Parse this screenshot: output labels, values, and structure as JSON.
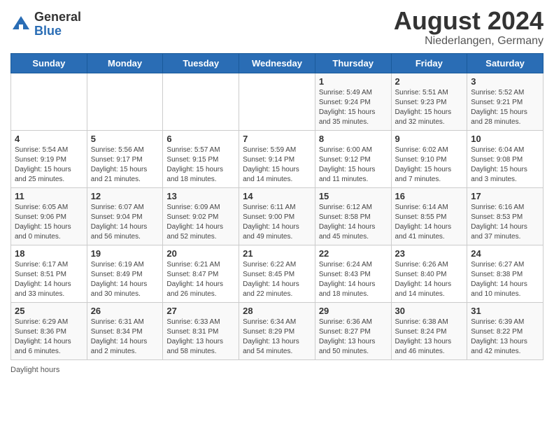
{
  "header": {
    "logo_general": "General",
    "logo_blue": "Blue",
    "month_year": "August 2024",
    "location": "Niederlangen, Germany"
  },
  "footer": {
    "daylight_label": "Daylight hours"
  },
  "days_of_week": [
    "Sunday",
    "Monday",
    "Tuesday",
    "Wednesday",
    "Thursday",
    "Friday",
    "Saturday"
  ],
  "weeks": [
    [
      {
        "day": "",
        "info": ""
      },
      {
        "day": "",
        "info": ""
      },
      {
        "day": "",
        "info": ""
      },
      {
        "day": "",
        "info": ""
      },
      {
        "day": "1",
        "info": "Sunrise: 5:49 AM\nSunset: 9:24 PM\nDaylight: 15 hours\nand 35 minutes."
      },
      {
        "day": "2",
        "info": "Sunrise: 5:51 AM\nSunset: 9:23 PM\nDaylight: 15 hours\nand 32 minutes."
      },
      {
        "day": "3",
        "info": "Sunrise: 5:52 AM\nSunset: 9:21 PM\nDaylight: 15 hours\nand 28 minutes."
      }
    ],
    [
      {
        "day": "4",
        "info": "Sunrise: 5:54 AM\nSunset: 9:19 PM\nDaylight: 15 hours\nand 25 minutes."
      },
      {
        "day": "5",
        "info": "Sunrise: 5:56 AM\nSunset: 9:17 PM\nDaylight: 15 hours\nand 21 minutes."
      },
      {
        "day": "6",
        "info": "Sunrise: 5:57 AM\nSunset: 9:15 PM\nDaylight: 15 hours\nand 18 minutes."
      },
      {
        "day": "7",
        "info": "Sunrise: 5:59 AM\nSunset: 9:14 PM\nDaylight: 15 hours\nand 14 minutes."
      },
      {
        "day": "8",
        "info": "Sunrise: 6:00 AM\nSunset: 9:12 PM\nDaylight: 15 hours\nand 11 minutes."
      },
      {
        "day": "9",
        "info": "Sunrise: 6:02 AM\nSunset: 9:10 PM\nDaylight: 15 hours\nand 7 minutes."
      },
      {
        "day": "10",
        "info": "Sunrise: 6:04 AM\nSunset: 9:08 PM\nDaylight: 15 hours\nand 3 minutes."
      }
    ],
    [
      {
        "day": "11",
        "info": "Sunrise: 6:05 AM\nSunset: 9:06 PM\nDaylight: 15 hours\nand 0 minutes."
      },
      {
        "day": "12",
        "info": "Sunrise: 6:07 AM\nSunset: 9:04 PM\nDaylight: 14 hours\nand 56 minutes."
      },
      {
        "day": "13",
        "info": "Sunrise: 6:09 AM\nSunset: 9:02 PM\nDaylight: 14 hours\nand 52 minutes."
      },
      {
        "day": "14",
        "info": "Sunrise: 6:11 AM\nSunset: 9:00 PM\nDaylight: 14 hours\nand 49 minutes."
      },
      {
        "day": "15",
        "info": "Sunrise: 6:12 AM\nSunset: 8:58 PM\nDaylight: 14 hours\nand 45 minutes."
      },
      {
        "day": "16",
        "info": "Sunrise: 6:14 AM\nSunset: 8:55 PM\nDaylight: 14 hours\nand 41 minutes."
      },
      {
        "day": "17",
        "info": "Sunrise: 6:16 AM\nSunset: 8:53 PM\nDaylight: 14 hours\nand 37 minutes."
      }
    ],
    [
      {
        "day": "18",
        "info": "Sunrise: 6:17 AM\nSunset: 8:51 PM\nDaylight: 14 hours\nand 33 minutes."
      },
      {
        "day": "19",
        "info": "Sunrise: 6:19 AM\nSunset: 8:49 PM\nDaylight: 14 hours\nand 30 minutes."
      },
      {
        "day": "20",
        "info": "Sunrise: 6:21 AM\nSunset: 8:47 PM\nDaylight: 14 hours\nand 26 minutes."
      },
      {
        "day": "21",
        "info": "Sunrise: 6:22 AM\nSunset: 8:45 PM\nDaylight: 14 hours\nand 22 minutes."
      },
      {
        "day": "22",
        "info": "Sunrise: 6:24 AM\nSunset: 8:43 PM\nDaylight: 14 hours\nand 18 minutes."
      },
      {
        "day": "23",
        "info": "Sunrise: 6:26 AM\nSunset: 8:40 PM\nDaylight: 14 hours\nand 14 minutes."
      },
      {
        "day": "24",
        "info": "Sunrise: 6:27 AM\nSunset: 8:38 PM\nDaylight: 14 hours\nand 10 minutes."
      }
    ],
    [
      {
        "day": "25",
        "info": "Sunrise: 6:29 AM\nSunset: 8:36 PM\nDaylight: 14 hours\nand 6 minutes."
      },
      {
        "day": "26",
        "info": "Sunrise: 6:31 AM\nSunset: 8:34 PM\nDaylight: 14 hours\nand 2 minutes."
      },
      {
        "day": "27",
        "info": "Sunrise: 6:33 AM\nSunset: 8:31 PM\nDaylight: 13 hours\nand 58 minutes."
      },
      {
        "day": "28",
        "info": "Sunrise: 6:34 AM\nSunset: 8:29 PM\nDaylight: 13 hours\nand 54 minutes."
      },
      {
        "day": "29",
        "info": "Sunrise: 6:36 AM\nSunset: 8:27 PM\nDaylight: 13 hours\nand 50 minutes."
      },
      {
        "day": "30",
        "info": "Sunrise: 6:38 AM\nSunset: 8:24 PM\nDaylight: 13 hours\nand 46 minutes."
      },
      {
        "day": "31",
        "info": "Sunrise: 6:39 AM\nSunset: 8:22 PM\nDaylight: 13 hours\nand 42 minutes."
      }
    ]
  ]
}
